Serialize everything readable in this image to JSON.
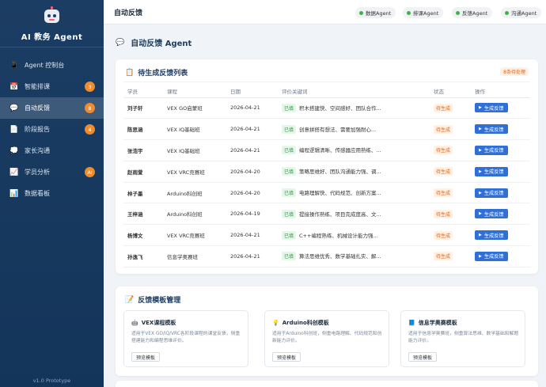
{
  "app": {
    "title": "AI 教务 Agent",
    "version": "v1.0 Prototype"
  },
  "sidebar": {
    "items": [
      {
        "label": "Agent 控制台",
        "icon": "phone-icon",
        "glyph": "📱",
        "badge": ""
      },
      {
        "label": "智能排课",
        "icon": "calendar-icon",
        "glyph": "📅",
        "badge": "3"
      },
      {
        "label": "自动反馈",
        "icon": "chat-bubble-icon",
        "glyph": "💬",
        "badge": "8",
        "active": true
      },
      {
        "label": "阶段报告",
        "icon": "document-icon",
        "glyph": "📄",
        "badge": "4"
      },
      {
        "label": "家长沟通",
        "icon": "speech-icon",
        "glyph": "💭",
        "badge": ""
      },
      {
        "label": "学员分析",
        "icon": "chart-icon",
        "glyph": "📈",
        "badge": "AI"
      },
      {
        "label": "数据看板",
        "icon": "bar-chart-icon",
        "glyph": "📊",
        "badge": ""
      }
    ]
  },
  "topbar": {
    "title": "自动反馈",
    "agents": [
      "数据Agent",
      "排课Agent",
      "反馈Agent",
      "沟通Agent"
    ]
  },
  "page": {
    "heading": "自动反馈 Agent"
  },
  "pending": {
    "title": "待生成反馈列表",
    "badge": "8条待处理",
    "columns": [
      "学员",
      "课程",
      "日期",
      "评价关键词",
      "状态",
      "操作"
    ],
    "kw_tag": "已填",
    "status_label": "待生成",
    "action_label": "生成反馈",
    "rows": [
      {
        "name": "刘子轩",
        "course": "VEX GO启蒙班",
        "date": "2026-04-21",
        "keywords": "积木搭建快、空间感好、团队合作..."
      },
      {
        "name": "陈思涵",
        "course": "VEX IQ基础班",
        "date": "2026-04-21",
        "keywords": "创意拼搭有想法、需要加强耐心..."
      },
      {
        "name": "张浩宇",
        "course": "VEX IQ基础班",
        "date": "2026-04-21",
        "keywords": "编程逻辑清晰、传感器应用熟练、..."
      },
      {
        "name": "赵雨萱",
        "course": "VEX VRC竞赛班",
        "date": "2026-04-20",
        "keywords": "策略思维好、团队沟通能力强、调..."
      },
      {
        "name": "林子墨",
        "course": "Arduino科创班",
        "date": "2026-04-20",
        "keywords": "电路理解快、代码规范、创新方案..."
      },
      {
        "name": "王梓涵",
        "course": "Arduino科创班",
        "date": "2026-04-19",
        "keywords": "提接操作熟练、项目完成度高、文..."
      },
      {
        "name": "杨博文",
        "course": "VEX VRC竞赛班",
        "date": "2026-04-21",
        "keywords": "C++编程熟练、机械设计能力强..."
      },
      {
        "name": "孙逸飞",
        "course": "信息学奥赛班",
        "date": "2026-04-21",
        "keywords": "算法思维优秀、数学基础扎实、解..."
      }
    ]
  },
  "templates": {
    "title": "反馈模板管理",
    "preview_label": "预览模板",
    "items": [
      {
        "title": "VEX课程模板",
        "icon": "robot-icon",
        "glyph": "🤖",
        "desc": "适用于VEX GO/IQ/VRC各阶段课程的课堂反馈，侧重搭建能力和编程思维评价。"
      },
      {
        "title": "Arduino科创模板",
        "icon": "bulb-icon",
        "glyph": "💡",
        "desc": "适用于Arduino科创班，侧重电路理解、代码规范和创新能力评价。"
      },
      {
        "title": "信息学奥赛模板",
        "icon": "book-icon",
        "glyph": "📘",
        "desc": "适用于信息学奥赛班，侧重算法思维、数学基础和解题能力评价。"
      }
    ]
  },
  "colors": {
    "sidebar": "#1c3d63",
    "accent": "#2f6fd6",
    "badge": "#f08c2a",
    "online": "#3db44b"
  }
}
